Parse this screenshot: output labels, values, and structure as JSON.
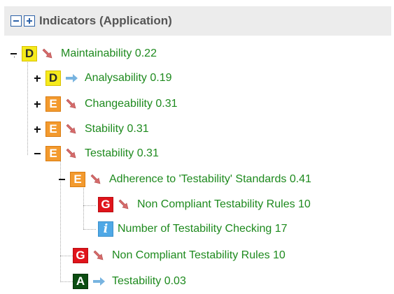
{
  "header": {
    "title": "Indicators (Application)"
  },
  "icons": {
    "down": "trend-down-icon",
    "right": "trend-right-icon"
  },
  "colors": {
    "label_green": "#1e8a1e",
    "grade_D": "#f5ea1c",
    "grade_E": "#f39a2e",
    "grade_G": "#e0141b",
    "grade_A": "#0c4d12",
    "grade_info": "#4fa8e6",
    "trend_down": "#d66b6b",
    "trend_right": "#78b4e0"
  },
  "tree": [
    {
      "grade": "D",
      "toggle": "minus",
      "trend": "down",
      "label": "Maintainability 0.22"
    },
    {
      "grade": "D",
      "toggle": "plus",
      "trend": "right",
      "label": "Analysability 0.19"
    },
    {
      "grade": "E",
      "toggle": "plus",
      "trend": "down",
      "label": "Changeability 0.31"
    },
    {
      "grade": "E",
      "toggle": "plus",
      "trend": "down",
      "label": "Stability 0.31"
    },
    {
      "grade": "E",
      "toggle": "minus",
      "trend": "down",
      "label": "Testability 0.31"
    },
    {
      "grade": "E",
      "toggle": "minus",
      "trend": "down",
      "label": "Adherence to 'Testability' Standards 0.41"
    },
    {
      "grade": "G",
      "toggle": "",
      "trend": "down",
      "label": "Non Compliant Testability Rules 10"
    },
    {
      "grade": "i",
      "toggle": "",
      "trend": "",
      "label": "Number of Testability Checking 17"
    },
    {
      "grade": "G",
      "toggle": "",
      "trend": "down",
      "label": "Non Compliant Testability Rules 10"
    },
    {
      "grade": "A",
      "toggle": "",
      "trend": "right",
      "label": "Testability 0.03"
    }
  ]
}
